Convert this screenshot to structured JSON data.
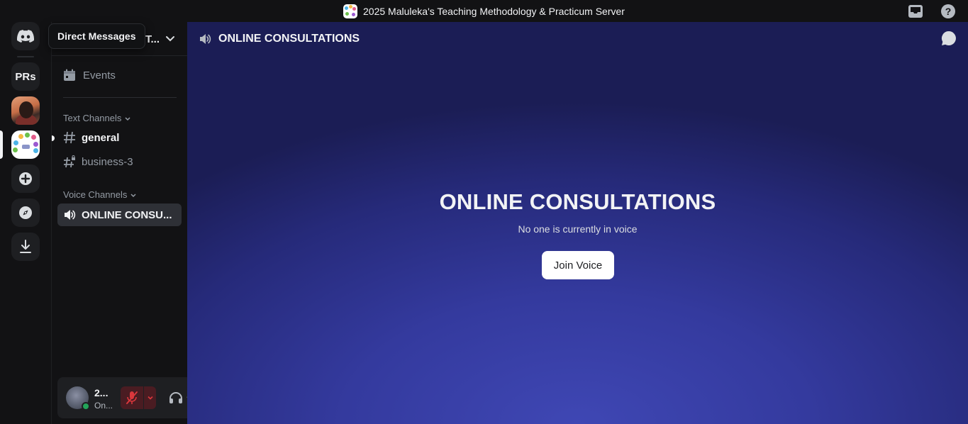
{
  "window": {
    "title": "2025 Maluleka's Teaching Methodology & Practicum Server",
    "right_icons": [
      "inbox-icon",
      "help-icon"
    ]
  },
  "rail": {
    "tooltip": "Direct Messages",
    "servers": [
      {
        "name": "home",
        "icon": "discord-icon"
      },
      {
        "name": "prs",
        "label": "PRs"
      },
      {
        "name": "photo-server",
        "icon": "avatar-photo"
      },
      {
        "name": "methodology-server",
        "icon": "mindmap-image",
        "selected": true
      },
      {
        "name": "add-server",
        "icon": "plus-icon"
      },
      {
        "name": "discover",
        "icon": "compass-icon"
      },
      {
        "name": "download",
        "icon": "download-icon"
      }
    ]
  },
  "sidebar": {
    "server_name": "T...",
    "events_label": "Events",
    "text_category": "Text Channels",
    "voice_category": "Voice Channels",
    "text_channels": [
      {
        "label": "general",
        "unread": true
      },
      {
        "label": "business-3",
        "locked": true
      }
    ],
    "voice_channels": [
      {
        "label": "ONLINE CONSU...",
        "selected": true
      }
    ]
  },
  "user": {
    "name": "2...",
    "status": "On...",
    "status_color": "#23a55a",
    "mic_muted": true
  },
  "voice": {
    "channel_title": "ONLINE CONSULTATIONS",
    "heading": "ONLINE CONSULTATIONS",
    "empty_text": "No one is currently in voice",
    "join_label": "Join Voice"
  },
  "colors": {
    "accent_blue": "#3f47b4",
    "muted_red": "#da373c",
    "online_green": "#23a55a"
  }
}
